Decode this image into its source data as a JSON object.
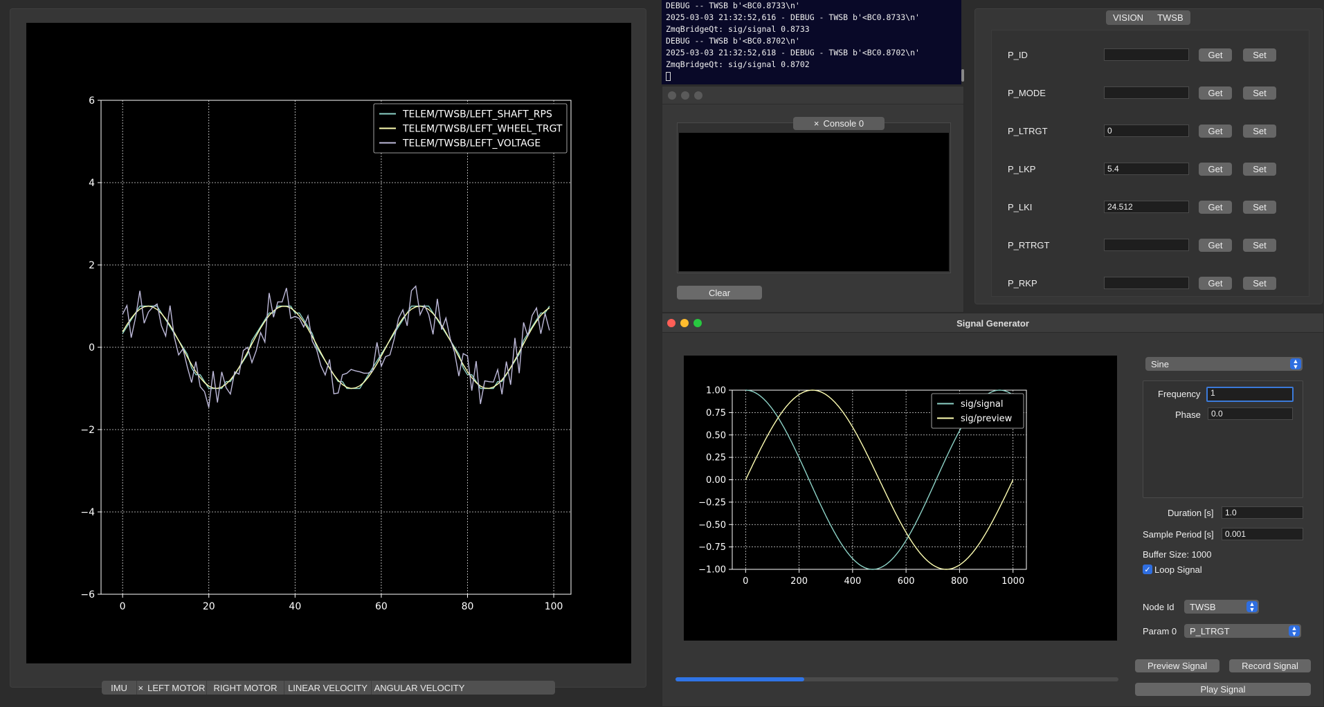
{
  "terminal": {
    "lines": [
      "DEBUG -- TWSB b'<BC0.8733\\n'",
      "2025-03-03 21:32:52,616 - DEBUG - TWSB b'<BC0.8733\\n'",
      "ZmqBridgeQt: sig/signal 0.8733",
      "DEBUG -- TWSB b'<BC0.8702\\n'",
      "2025-03-03 21:32:52,618 - DEBUG - TWSB b'<BC0.8702\\n'",
      "ZmqBridgeQt: sig/signal 0.8702"
    ]
  },
  "console": {
    "tab_label": "Console 0",
    "close_glyph": "×",
    "clear_label": "Clear"
  },
  "params": {
    "tabs": [
      "VISION",
      "TWSB"
    ],
    "get_label": "Get",
    "set_label": "Set",
    "rows": [
      {
        "name": "P_ID",
        "value": ""
      },
      {
        "name": "P_MODE",
        "value": ""
      },
      {
        "name": "P_LTRGT",
        "value": "0"
      },
      {
        "name": "P_LKP",
        "value": "5.4"
      },
      {
        "name": "P_LKI",
        "value": "24.512"
      },
      {
        "name": "P_RTRGT",
        "value": ""
      },
      {
        "name": "P_RKP",
        "value": ""
      }
    ]
  },
  "bottom_tabs": [
    {
      "label": "IMU",
      "closable": false
    },
    {
      "label": "LEFT MOTOR",
      "closable": true
    },
    {
      "label": "RIGHT MOTOR",
      "closable": false
    },
    {
      "label": "LINEAR VELOCITY",
      "closable": false
    },
    {
      "label": "ANGULAR VELOCITY",
      "closable": false
    }
  ],
  "signal_generator": {
    "title": "Signal Generator",
    "waveform": "Sine",
    "frequency_label": "Frequency",
    "frequency_value": "1",
    "phase_label": "Phase",
    "phase_value": "0.0",
    "duration_label": "Duration [s]",
    "duration_value": "1.0",
    "sample_period_label": "Sample Period [s]",
    "sample_period_value": "0.001",
    "buffer_size_text": "Buffer Size: 1000",
    "loop_label": "Loop Signal",
    "loop_checked": true,
    "node_id_label": "Node Id",
    "node_id_value": "TWSB",
    "param_label": "Param 0",
    "param_value": "P_LTRGT",
    "preview_label": "Preview Signal",
    "record_label": "Record Signal",
    "play_label": "Play Signal",
    "progress": 0.29
  },
  "chart_data": [
    {
      "type": "line",
      "xlim": [
        -5,
        104
      ],
      "ylim": [
        -6,
        6
      ],
      "xticks": [
        0,
        20,
        40,
        60,
        80,
        100
      ],
      "yticks": [
        -6,
        -4,
        -2,
        0,
        2,
        4,
        6
      ],
      "grid": true,
      "legend_position": "top-right",
      "series": [
        {
          "name": "TELEM/TWSB/LEFT_SHAFT_RPS",
          "color": "#8dd3c7",
          "kind": "sine_stepped",
          "amplitude": 1.0,
          "period": 31.5,
          "phase_deg": 22,
          "offset": 0
        },
        {
          "name": "TELEM/TWSB/LEFT_WHEEL_TRGT",
          "color": "#ffffb3",
          "kind": "sine",
          "amplitude": 1.0,
          "period": 31.5,
          "phase_deg": 22,
          "offset": 0
        },
        {
          "name": "TELEM/TWSB/LEFT_VOLTAGE",
          "color": "#bebada",
          "kind": "sine_noisy",
          "amplitude": 1.0,
          "period": 31.5,
          "phase_deg": 22,
          "offset": 0,
          "noise": 0.55
        }
      ]
    },
    {
      "type": "line",
      "xlim": [
        -50,
        1050
      ],
      "ylim": [
        -1.0,
        1.0
      ],
      "xticks": [
        0,
        200,
        400,
        600,
        800,
        1000
      ],
      "yticks": [
        -1.0,
        -0.75,
        -0.5,
        -0.25,
        0.0,
        0.25,
        0.5,
        0.75,
        1.0
      ],
      "ytick_labels": [
        "−1.00",
        "−0.75",
        "−0.50",
        "−0.25",
        "0.00",
        "0.25",
        "0.50",
        "0.75",
        "1.00"
      ],
      "grid": true,
      "legend_position": "top-right",
      "series": [
        {
          "name": "sig/signal",
          "color": "#8dd3c7",
          "kind": "sine",
          "amplitude": 1.0,
          "period": 950,
          "phase_deg": 90,
          "offset": 0
        },
        {
          "name": "sig/preview",
          "color": "#ffffb3",
          "kind": "sine",
          "amplitude": 1.0,
          "period": 1000,
          "phase_deg": 0,
          "offset": 0
        }
      ]
    }
  ]
}
